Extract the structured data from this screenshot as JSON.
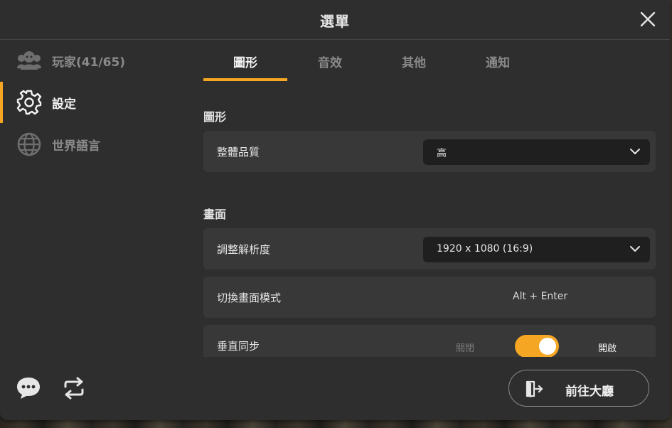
{
  "window": {
    "title": "選單",
    "close_icon": "close-icon"
  },
  "sidebar": {
    "items": [
      {
        "label": "玩家(41/65)",
        "icon": "players-icon",
        "active": false
      },
      {
        "label": "設定",
        "icon": "gear-icon",
        "active": true
      },
      {
        "label": "世界語言",
        "icon": "globe-icon",
        "active": false
      }
    ],
    "bottom_icons": [
      "chat-bubble-icon",
      "refresh-icon"
    ]
  },
  "tabs": [
    {
      "label": "圖形",
      "active": true
    },
    {
      "label": "音效",
      "active": false
    },
    {
      "label": "其他",
      "active": false
    },
    {
      "label": "通知",
      "active": false
    }
  ],
  "sections": {
    "graphics": {
      "title": "圖形",
      "quality": {
        "label": "整體品質",
        "value": "高"
      }
    },
    "display": {
      "title": "畫面",
      "resolution": {
        "label": "調整解析度",
        "value": "1920 x 1080 (16:9)"
      },
      "screen_mode": {
        "label": "切換畫面模式",
        "value": "Alt + Enter"
      },
      "vsync": {
        "label": "垂直同步",
        "off_label": "關閉",
        "on_label": "開啟",
        "enabled": true
      }
    }
  },
  "footer": {
    "lobby_button": "前往大廳",
    "lobby_icon": "exit-door-icon"
  },
  "colors": {
    "accent": "#f5a623",
    "panel": "#2e2e2e",
    "row": "#383838",
    "dropdown": "#1f1f1f"
  }
}
